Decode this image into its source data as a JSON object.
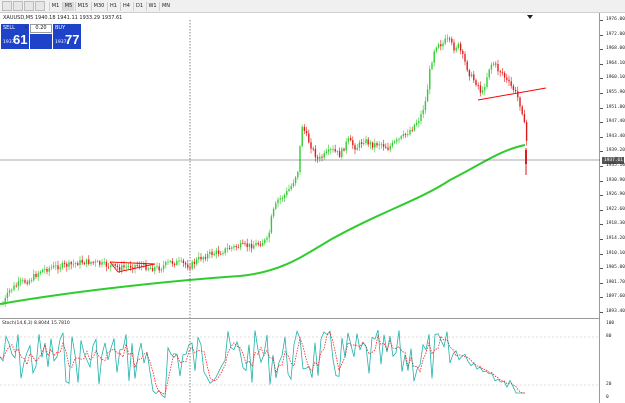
{
  "toolbar": {
    "timeframes": [
      "M1",
      "M5",
      "M15",
      "M30",
      "H1",
      "H4",
      "D1",
      "W1",
      "MN"
    ],
    "active_timeframe": "M5"
  },
  "chart": {
    "symbol_info": "XAUUSD,M5  1940.18 1941.11 1933.29 1937.61",
    "price_axis_labels": [
      "1976.00",
      "1972.00",
      "1968.00",
      "1964.10",
      "1960.10",
      "1955.90",
      "1951.80",
      "1947.40",
      "1943.40",
      "1939.20",
      "1935.10",
      "1930.90",
      "1926.90",
      "1922.60",
      "1918.30",
      "1914.20",
      "1910.10",
      "1905.80",
      "1901.70",
      "1897.60",
      "1893.40"
    ],
    "current_price": "1937.61",
    "colors": {
      "bull_candle": "#2ecc2e",
      "bear_candle": "#e01a1a",
      "moving_average": "#2fcc2f",
      "trendline": "#ff0000",
      "stoch_main": "#20b2aa",
      "stoch_signal": "#ff2020",
      "sell_buy_bg": "#1e43c8"
    }
  },
  "one_click": {
    "sell_label": "SELL",
    "buy_label": "BUY",
    "lot_value": "0.20",
    "sell_price_small": "1937",
    "sell_price_big": "61",
    "buy_price_small": "1937",
    "buy_price_big": "77"
  },
  "indicator": {
    "label": "Stoch(14,6,3) 8.8044 15.7810",
    "levels": [
      "80",
      "20",
      "0"
    ],
    "top_label": "100"
  }
}
